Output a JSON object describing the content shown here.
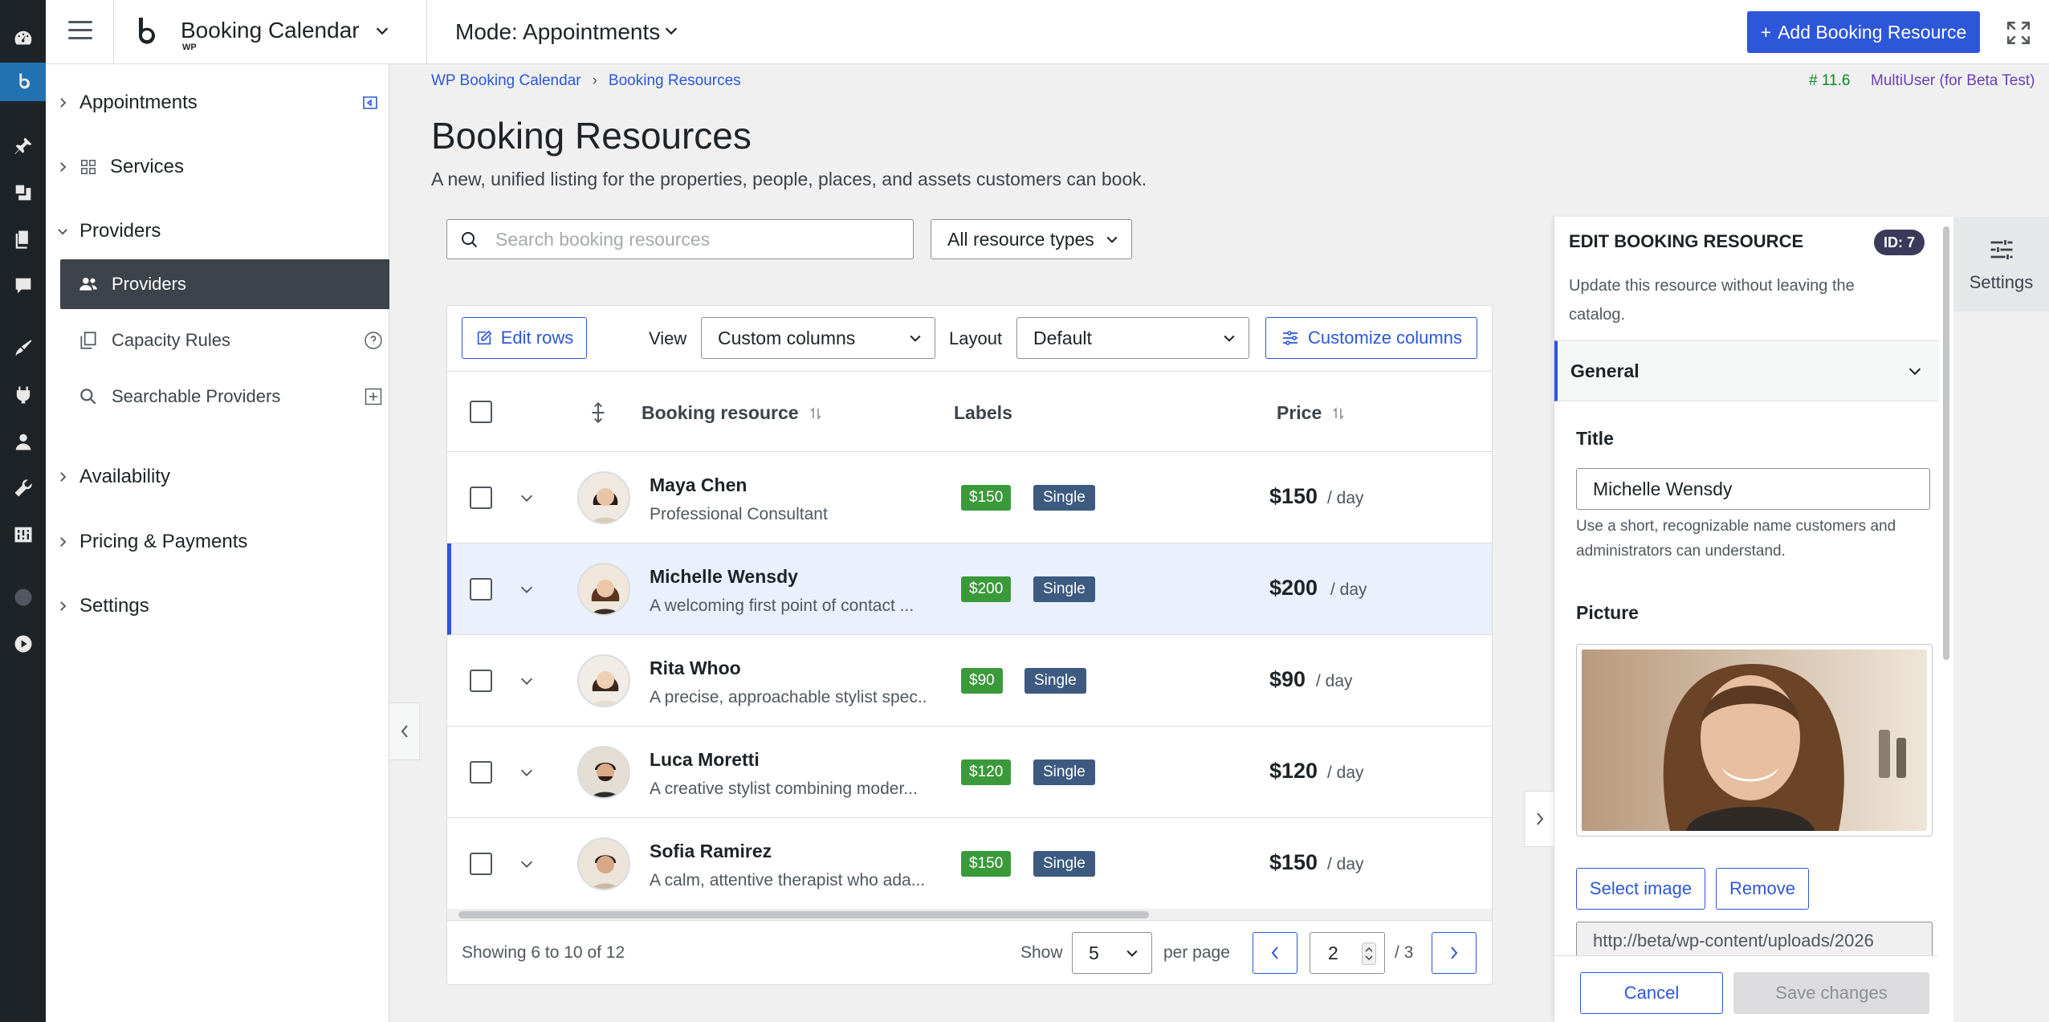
{
  "topbar": {
    "brand_name": "Booking Calendar",
    "brand_sub": "WP",
    "mode": "Mode: Appointments",
    "add_button": "Add Booking Resource"
  },
  "sidebar": {
    "groups": {
      "appointments": "Appointments",
      "services": "Services",
      "providers": "Providers",
      "availability": "Availability",
      "pricing": "Pricing & Payments",
      "settings": "Settings"
    },
    "items": {
      "providers": "Providers",
      "capacity": "Capacity Rules",
      "searchable": "Searchable Providers"
    }
  },
  "breadcrumb": {
    "root": "WP Booking Calendar",
    "current": "Booking Resources"
  },
  "version": "# 11.6",
  "edition": "MultiUser (for Beta Test)",
  "page": {
    "title": "Booking Resources",
    "description": "A new, unified listing for the properties, people, places, and assets customers can book."
  },
  "filters": {
    "search_placeholder": "Search booking resources",
    "type_select": "All resource types"
  },
  "table": {
    "edit_rows": "Edit rows",
    "view_label": "View",
    "view_value": "Custom columns",
    "layout_label": "Layout",
    "layout_value": "Default",
    "customize": "Customize columns",
    "headers": {
      "resource": "Booking resource",
      "labels": "Labels",
      "price": "Price"
    },
    "rows": [
      {
        "name": "Maya Chen",
        "desc": "Professional Consultant",
        "badge": "$150",
        "type": "Single",
        "price": "$150",
        "per": "/ day"
      },
      {
        "name": "Michelle Wensdy",
        "desc": "A welcoming first point of contact ...",
        "badge": "$200",
        "type": "Single",
        "price": "$200",
        "per": "/ day"
      },
      {
        "name": "Rita Whoo",
        "desc": "A precise, approachable stylist spec...",
        "badge": "$90",
        "type": "Single",
        "price": "$90",
        "per": "/ day"
      },
      {
        "name": "Luca Moretti",
        "desc": "A creative stylist combining moder...",
        "badge": "$120",
        "type": "Single",
        "price": "$120",
        "per": "/ day"
      },
      {
        "name": "Sofia Ramirez",
        "desc": "A calm, attentive therapist who ada...",
        "badge": "$150",
        "type": "Single",
        "price": "$150",
        "per": "/ day"
      }
    ],
    "footer": {
      "showing": "Showing 6 to 10 of 12",
      "show_label": "Show",
      "per_page_value": "5",
      "per_page_label": "per page",
      "current_page": "2",
      "total_pages": "/ 3"
    }
  },
  "panel": {
    "title": "EDIT BOOKING RESOURCE",
    "id_badge": "ID: 7",
    "subtitle": "Update this resource without leaving the catalog.",
    "section": "General",
    "title_label": "Title",
    "title_value": "Michelle Wensdy",
    "title_help": "Use a short, recognizable name customers and administrators can understand.",
    "picture_label": "Picture",
    "select_image": "Select image",
    "remove": "Remove",
    "url": "http://beta/wp-content/uploads/2026",
    "cancel": "Cancel",
    "save": "Save changes"
  },
  "settings_tab": "Settings",
  "colors": {
    "accent": "#2d56d8",
    "price_badge": "#3a9a3a",
    "type_badge": "#3d5a80",
    "rail": "#1d2327"
  }
}
